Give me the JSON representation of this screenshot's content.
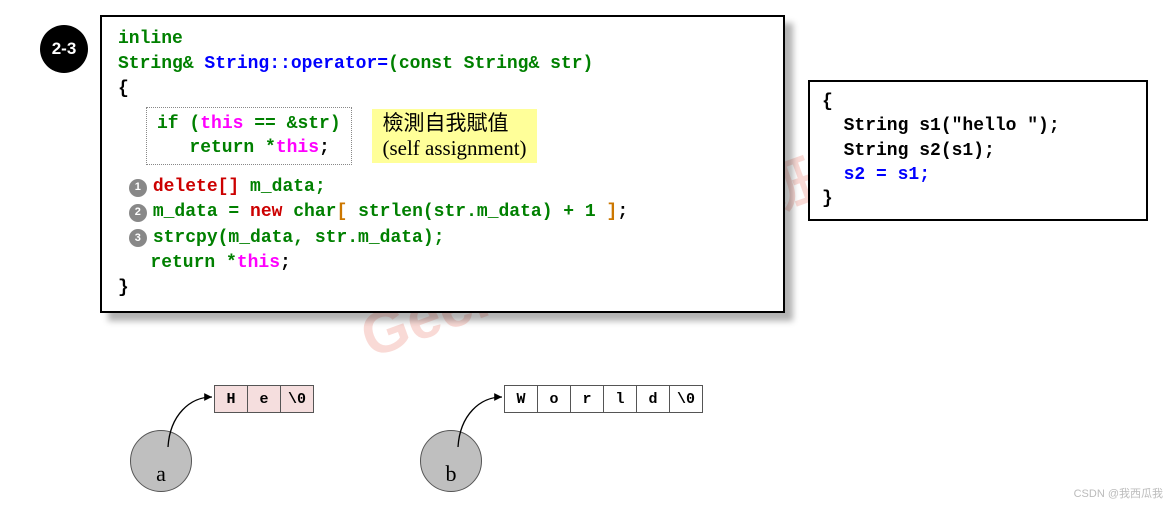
{
  "badge": "2-3",
  "watermark_en": "GeekBand",
  "watermark_cn": "极客班",
  "footer": "CSDN @我西瓜我",
  "main": {
    "l1": "inline",
    "l2_a": "String& ",
    "l2_b": "String::operator=",
    "l2_c": "(const String& str)",
    "l3": "{",
    "box_1a": "if (",
    "box_1b": "this",
    "box_1c": " == &str)",
    "box_2a": "   return *",
    "box_2b": "this",
    "box_2c": ";",
    "hi_1": "檢測自我賦值",
    "hi_2": "(self assignment)",
    "s1_a": "delete[]",
    "s1_b": " m_data;",
    "s2_a": "m_data = ",
    "s2_b": "new",
    "s2_c": " char",
    "s2_lb": "[",
    "s2_d": " strlen(str.m_data) + 1 ",
    "s2_rb": "]",
    "s2_e": ";",
    "s3_a": "strcpy(m_data, str.m_data);",
    "s4_a": "return *",
    "s4_b": "this",
    "s4_c": ";",
    "l_end": "}"
  },
  "side": {
    "l1": "{",
    "l2": "  String s1(\"hello \");",
    "l3": "  String s2(s1);",
    "l4_a": "  ",
    "l4_b": "s2 = s1;",
    "l5": "}"
  },
  "steps": {
    "n1": "1",
    "n2": "2",
    "n3": "3"
  },
  "diagram": {
    "a_label": "a",
    "b_label": "b",
    "a_cells": [
      "H",
      "e",
      "\\0"
    ],
    "b_cells": [
      "W",
      "o",
      "r",
      "l",
      "d",
      "\\0"
    ]
  }
}
